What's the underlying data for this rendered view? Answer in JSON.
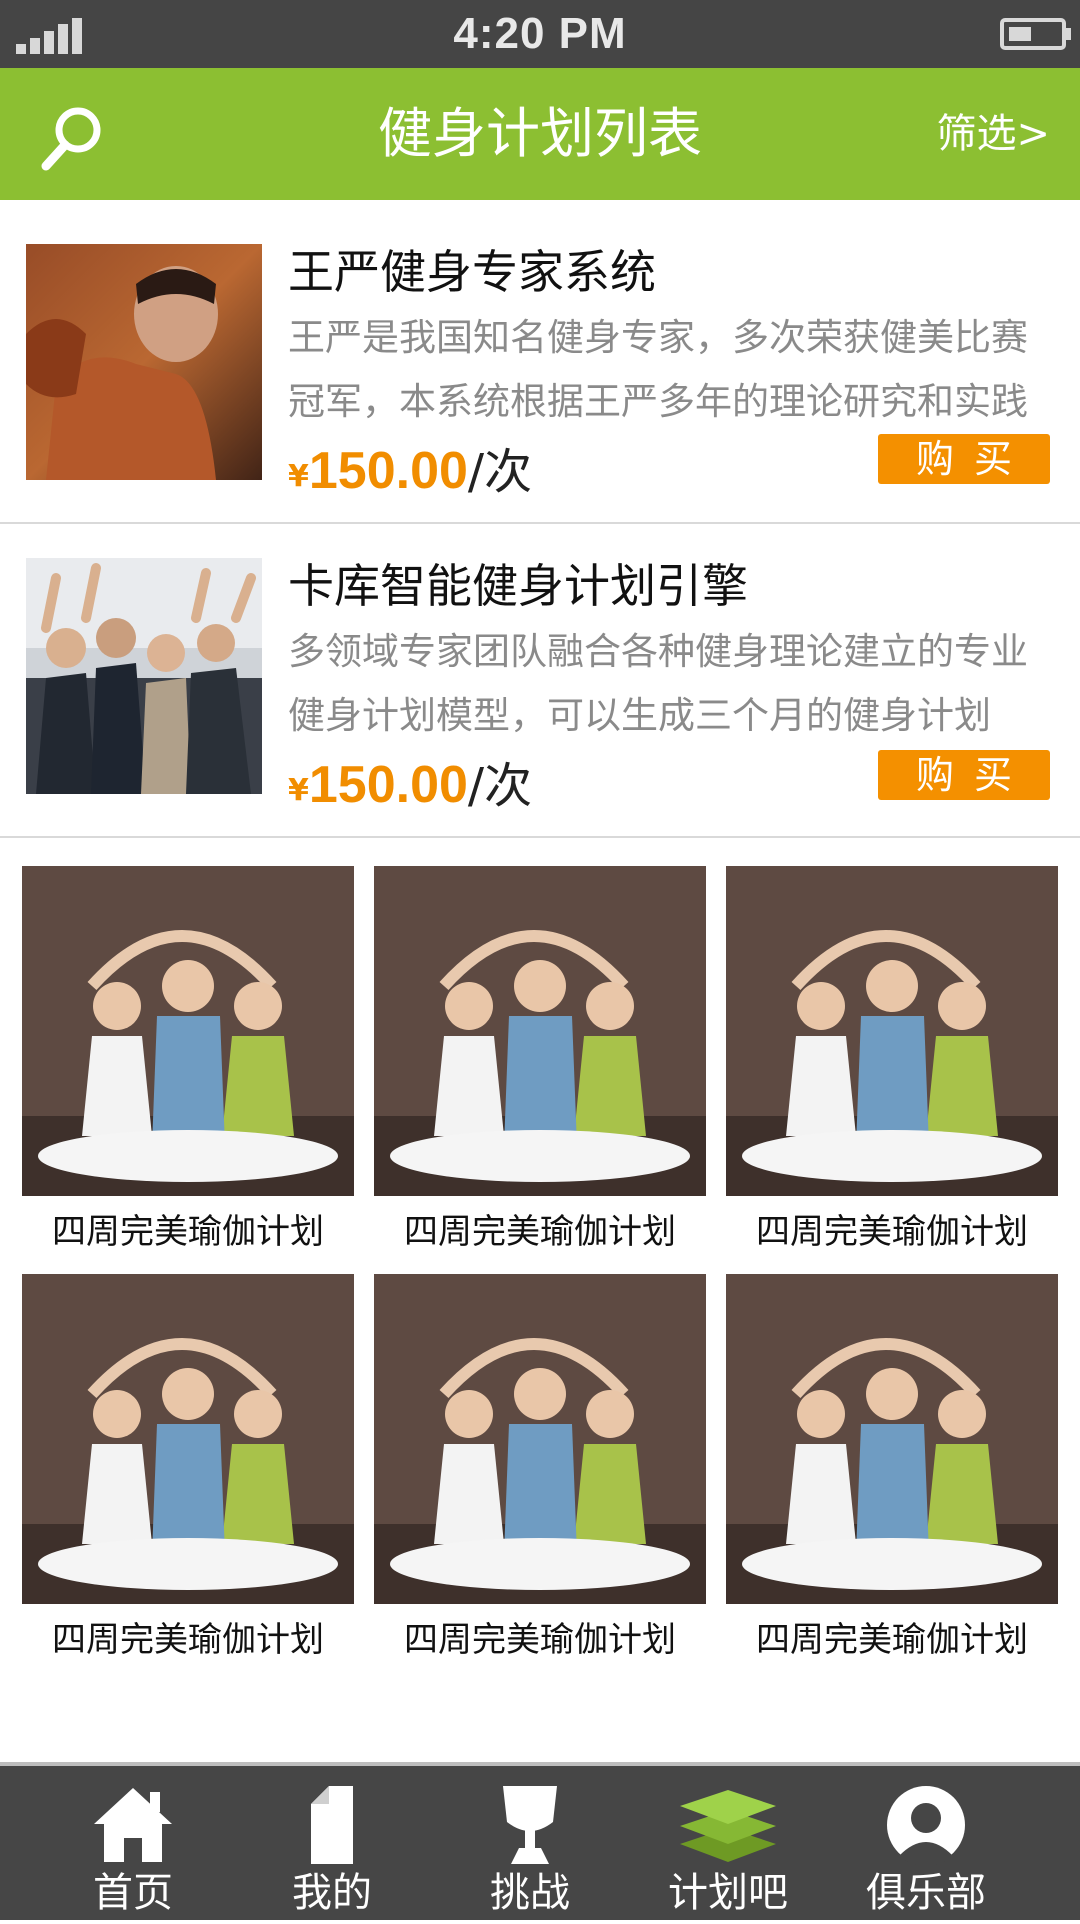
{
  "status_bar": {
    "time": "4:20 PM"
  },
  "header": {
    "title": "健身计划列表",
    "filter_label": "筛选>"
  },
  "plans": [
    {
      "title": "王严健身专家系统",
      "description": "王严是我国知名健身专家，多次荣获健美比赛冠军，本系统根据王严多年的理论研究和实践经验编写",
      "currency": "¥",
      "price": "150.00",
      "unit": "/次",
      "buy_label": "购买"
    },
    {
      "title": "卡库智能健身计划引擎",
      "description": "多领域专家团队融合各种健身理论建立的专业健身计划模型，可以生成三个月的健身计划",
      "currency": "¥",
      "price": "150.00",
      "unit": "/次",
      "buy_label": "购买"
    }
  ],
  "grid_items": [
    {
      "label": "四周完美瑜伽计划"
    },
    {
      "label": "四周完美瑜伽计划"
    },
    {
      "label": "四周完美瑜伽计划"
    },
    {
      "label": "四周完美瑜伽计划"
    },
    {
      "label": "四周完美瑜伽计划"
    },
    {
      "label": "四周完美瑜伽计划"
    }
  ],
  "bottom_nav": [
    {
      "label": "首页",
      "icon": "home-icon"
    },
    {
      "label": "我的",
      "icon": "document-icon"
    },
    {
      "label": "挑战",
      "icon": "trophy-icon"
    },
    {
      "label": "计划吧",
      "icon": "layers-icon",
      "active": true
    },
    {
      "label": "俱乐部",
      "icon": "user-icon"
    }
  ],
  "colors": {
    "header": "#8cbf32",
    "price": "#f18d00",
    "buy_button": "#f49000",
    "nav_bg": "#464646",
    "active_icon": "#8cbf32"
  }
}
